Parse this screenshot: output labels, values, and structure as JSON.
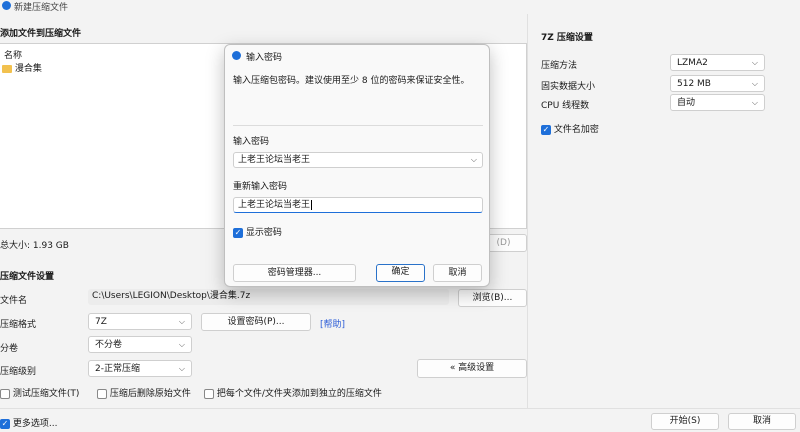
{
  "window": {
    "title": "新建压缩文件"
  },
  "files": {
    "section_title": "添加文件到压缩文件",
    "column_name": "名称",
    "items": [
      {
        "name": "漫合集"
      }
    ],
    "total_size": "总大小: 1.93 GB",
    "delete_label": "(D)"
  },
  "settings": {
    "section_title": "压缩文件设置",
    "filename_label": "文件名",
    "filename_value": "C:\\Users\\LEGION\\Desktop\\漫合集.7z",
    "browse_label": "浏览(B)...",
    "format_label": "压缩格式",
    "format_value": "7Z",
    "set_password_label": "设置密码(P)...",
    "help_label": "[帮助]",
    "split_label": "分卷",
    "split_value": "不分卷",
    "level_label": "压缩级别",
    "level_value": "2-正常压缩",
    "advanced_label": "« 高级设置",
    "test_label": "测试压缩文件(T)",
    "delete_after_label": "压缩后删除原始文件",
    "separate_label": "把每个文件/文件夹添加到独立的压缩文件"
  },
  "sevenz": {
    "section_title": "7Z 压缩设置",
    "method_label": "压缩方法",
    "method_value": "LZMA2",
    "solid_label": "固实数据大小",
    "solid_value": "512 MB",
    "threads_label": "CPU 线程数",
    "threads_value": "自动",
    "encrypt_names_label": "文件名加密",
    "encrypt_names_checked": true
  },
  "footer": {
    "more_options_label": "更多选项...",
    "start_label": "开始(S)",
    "cancel_label": "取消"
  },
  "dialog": {
    "title": "输入密码",
    "hint": "输入压缩包密码。建议使用至少 8 位的密码来保证安全性。",
    "password_label": "输入密码",
    "password_value": "上老王论坛当老王",
    "confirm_label": "重新输入密码",
    "confirm_value": "上老王论坛当老王",
    "show_password_label": "显示密码",
    "show_password_checked": true,
    "manager_label": "密码管理器...",
    "ok_label": "确定",
    "cancel_label": "取消"
  },
  "colors": {
    "accent": "#1e6fd9",
    "help_link": "#2a5bd7"
  }
}
